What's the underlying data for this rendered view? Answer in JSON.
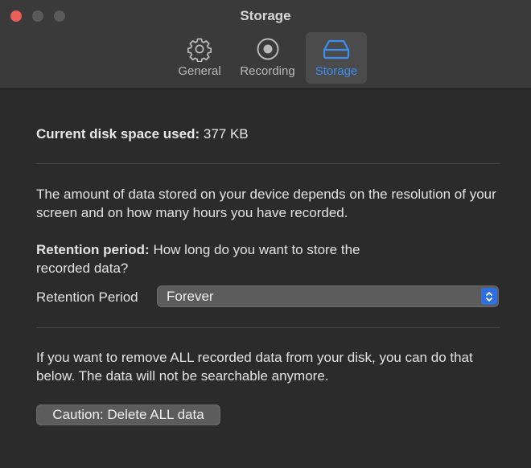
{
  "window": {
    "title": "Storage"
  },
  "toolbar": {
    "tabs": [
      {
        "label": "General",
        "icon": "gear-icon",
        "selected": false
      },
      {
        "label": "Recording",
        "icon": "record-icon",
        "selected": false
      },
      {
        "label": "Storage",
        "icon": "drive-icon",
        "selected": true
      }
    ]
  },
  "storage": {
    "disk_label": "Current disk space used:",
    "disk_value": "377 KB",
    "description": "The amount of data stored on your device depends on the resolution of your screen and on how many hours you have recorded.",
    "retention_heading": "Retention period:",
    "retention_question": "How long do you want to store the recorded data?",
    "retention_field_label": "Retention Period",
    "retention_value": "Forever",
    "delete_description": "If you want to remove ALL recorded data from your disk, you can do that below. The data will not be searchable anymore.",
    "delete_button_label": "Caution: Delete ALL data"
  },
  "colors": {
    "accent": "#3d8df5",
    "close_button": "#ec5f59",
    "window_background": "#2b2b2b",
    "titlebar_background": "#3a3a3a"
  }
}
